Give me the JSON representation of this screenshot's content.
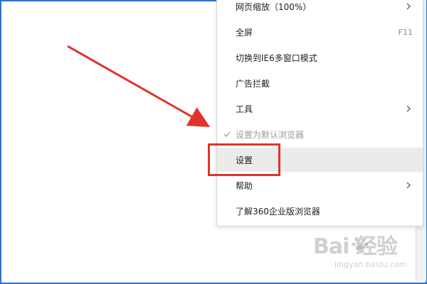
{
  "menu": {
    "items": [
      {
        "label": "网页缩放（100%）",
        "has_submenu": true
      },
      {
        "label": "全屏",
        "shortcut": "F11"
      },
      {
        "label": "切换到IE6多窗口模式"
      },
      {
        "label": "广告拦截"
      },
      {
        "label": "工具",
        "has_submenu": true
      },
      {
        "label": "设置为默认浏览器",
        "disabled": true,
        "checked": true
      },
      {
        "label": "设置",
        "highlighted": true
      },
      {
        "label": "帮助",
        "has_submenu": true
      },
      {
        "label": "了解360企业版浏览器"
      }
    ]
  },
  "annotation": {
    "color": "#e0342a"
  },
  "watermark": {
    "main": "Bai  经验",
    "sub": "jingyan.baidu.com"
  }
}
